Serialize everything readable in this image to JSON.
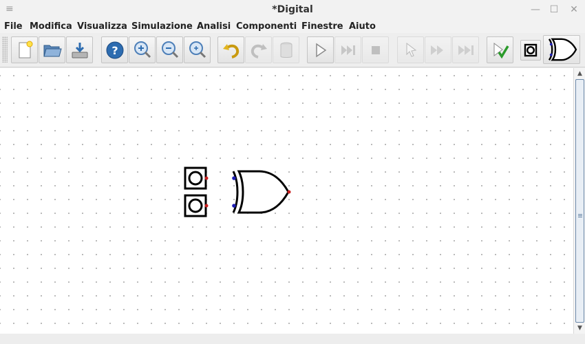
{
  "window": {
    "title": "*Digital",
    "menu_glyph": "≡",
    "minimize_glyph": "—",
    "maximize_glyph": "☐",
    "close_glyph": "✕"
  },
  "menubar": {
    "items": [
      "File",
      "Modifica",
      "Visualizza",
      "Simulazione",
      "Analisi",
      "Componenti",
      "Finestre",
      "Aiuto"
    ]
  },
  "toolbar": {
    "buttons": [
      {
        "icon": "new-file-icon",
        "enabled": true
      },
      {
        "icon": "open-folder-icon",
        "enabled": true
      },
      {
        "icon": "save-icon",
        "enabled": true
      },
      {
        "icon": "help-icon",
        "enabled": true
      },
      {
        "icon": "zoom-in-icon",
        "enabled": true
      },
      {
        "icon": "zoom-out-icon",
        "enabled": true
      },
      {
        "icon": "zoom-fit-icon",
        "enabled": true
      },
      {
        "icon": "undo-icon",
        "enabled": true
      },
      {
        "icon": "redo-icon",
        "enabled": false
      },
      {
        "icon": "delete-icon",
        "enabled": false
      },
      {
        "icon": "run-icon",
        "enabled": true
      },
      {
        "icon": "step-icon",
        "enabled": false
      },
      {
        "icon": "stop-icon",
        "enabled": false
      },
      {
        "icon": "micro-step-icon",
        "enabled": false
      },
      {
        "icon": "fast-run-icon",
        "enabled": false
      },
      {
        "icon": "run-to-break-icon",
        "enabled": false
      },
      {
        "icon": "analysis-check-icon",
        "enabled": true
      },
      {
        "icon": "input-component-icon",
        "enabled": true
      },
      {
        "icon": "xor-gate-icon",
        "enabled": true
      }
    ]
  },
  "colors": {
    "pin_in": "#1e1eb4",
    "pin_out": "#c81e1e",
    "wire": "#000000",
    "accent_check": "#2a9a2a"
  },
  "circuit": {
    "components": [
      {
        "type": "input",
        "name": "in-a"
      },
      {
        "type": "input",
        "name": "in-b"
      },
      {
        "type": "xor-gate",
        "name": "xor"
      }
    ]
  }
}
